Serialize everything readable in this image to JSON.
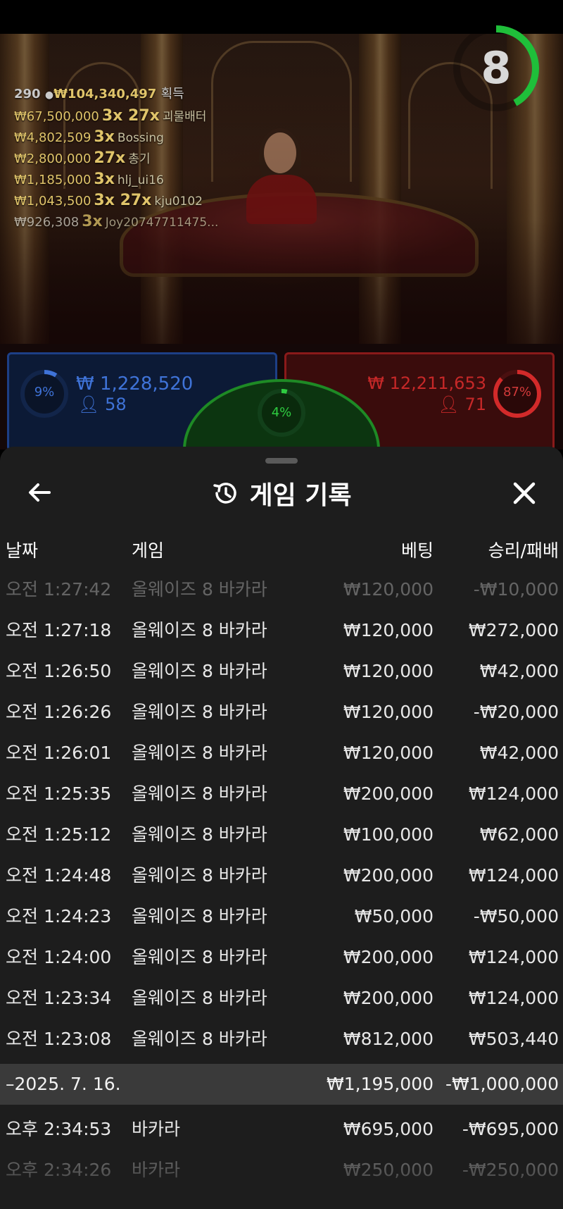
{
  "timer": {
    "value": "8",
    "fraction_remaining": 0.42
  },
  "winners": {
    "header": {
      "players": "290",
      "amount": "₩104,340,497",
      "label": "획득"
    },
    "rows": [
      {
        "amount": "₩67,500,000",
        "multipliers": "3x 27x",
        "name": "괴물배터"
      },
      {
        "amount": "₩4,802,509",
        "multipliers": "3x",
        "name": "Bossing"
      },
      {
        "amount": "₩2,800,000",
        "multipliers": "27x",
        "name": "총기"
      },
      {
        "amount": "₩1,185,000",
        "multipliers": "3x",
        "name": "hlj_ui16"
      },
      {
        "amount": "₩1,043,500",
        "multipliers": "3x 27x",
        "name": "kju0102"
      },
      {
        "amount": "₩926,308",
        "multipliers": "3x",
        "name": "Joy20747711475..."
      }
    ]
  },
  "bets": {
    "player": {
      "percent": "9%",
      "percent_value": 9,
      "amount": "₩ 1,228,520",
      "players": "58",
      "color": "#3f73d8"
    },
    "tie": {
      "percent": "4%",
      "percent_value": 4,
      "color": "#1e8a25"
    },
    "banker": {
      "percent": "87%",
      "percent_value": 87,
      "amount": "₩ 12,211,653",
      "players": "71",
      "color": "#c62828"
    }
  },
  "history": {
    "title": "게임 기록",
    "icons": {
      "back": "arrow-left-icon",
      "history": "history-icon",
      "close": "close-icon"
    },
    "columns": {
      "date": "날짜",
      "game": "게임",
      "bet": "베팅",
      "result": "승리/패배"
    },
    "rows": [
      {
        "date": "오전 1:27:42",
        "game": "올웨이즈 8 바카라",
        "bet": "₩120,000",
        "result": "-₩10,000"
      },
      {
        "date": "오전 1:27:18",
        "game": "올웨이즈 8 바카라",
        "bet": "₩120,000",
        "result": "₩272,000"
      },
      {
        "date": "오전 1:26:50",
        "game": "올웨이즈 8 바카라",
        "bet": "₩120,000",
        "result": "₩42,000"
      },
      {
        "date": "오전 1:26:26",
        "game": "올웨이즈 8 바카라",
        "bet": "₩120,000",
        "result": "-₩20,000"
      },
      {
        "date": "오전 1:26:01",
        "game": "올웨이즈 8 바카라",
        "bet": "₩120,000",
        "result": "₩42,000"
      },
      {
        "date": "오전 1:25:35",
        "game": "올웨이즈 8 바카라",
        "bet": "₩200,000",
        "result": "₩124,000"
      },
      {
        "date": "오전 1:25:12",
        "game": "올웨이즈 8 바카라",
        "bet": "₩100,000",
        "result": "₩62,000"
      },
      {
        "date": "오전 1:24:48",
        "game": "올웨이즈 8 바카라",
        "bet": "₩200,000",
        "result": "₩124,000"
      },
      {
        "date": "오전 1:24:23",
        "game": "올웨이즈 8 바카라",
        "bet": "₩50,000",
        "result": "-₩50,000"
      },
      {
        "date": "오전 1:24:00",
        "game": "올웨이즈 8 바카라",
        "bet": "₩200,000",
        "result": "₩124,000"
      },
      {
        "date": "오전 1:23:34",
        "game": "올웨이즈 8 바카라",
        "bet": "₩200,000",
        "result": "₩124,000"
      },
      {
        "date": "오전 1:23:08",
        "game": "올웨이즈 8 바카라",
        "bet": "₩812,000",
        "result": "₩503,440"
      }
    ],
    "group": {
      "date": "–2025. 7. 16.",
      "bet": "₩1,195,000",
      "result": "-₩1,000,000"
    },
    "group_rows": [
      {
        "date": "오후 2:34:53",
        "game": "바카라",
        "bet": "₩695,000",
        "result": "-₩695,000"
      },
      {
        "date": "오후 2:34:26",
        "game": "바카라",
        "bet": "₩250,000",
        "result": "-₩250,000"
      }
    ]
  }
}
